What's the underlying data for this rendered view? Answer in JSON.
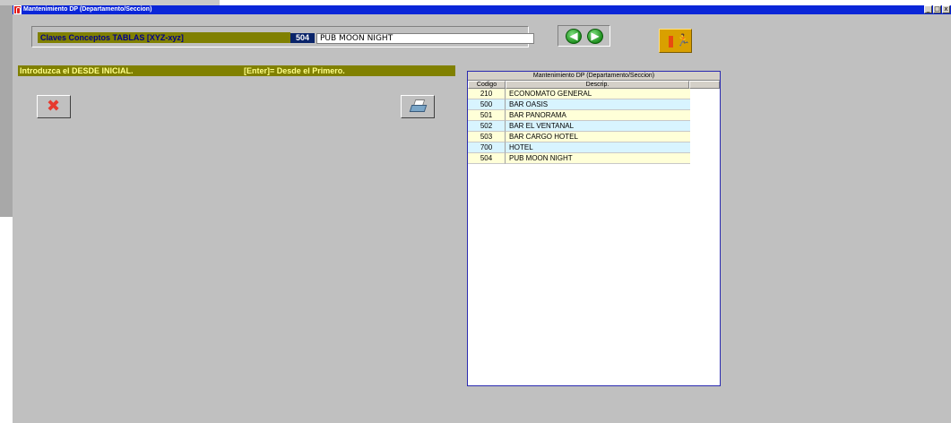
{
  "window": {
    "title": "Mantenimiento DP (Departamento/Seccion)",
    "min_label": "_",
    "max_label": "□",
    "close_label": "x"
  },
  "claves": {
    "label": "Claves Conceptos TABLAS [XYZ-xyz]",
    "code": "504",
    "description": "PUB MOON NIGHT"
  },
  "nav": {
    "prev_icon": "left-arrow-icon",
    "next_icon": "right-arrow-icon",
    "prev_glyph": "◀",
    "next_glyph": "▶"
  },
  "prompt": {
    "left": "Introduzca el DESDE INICIAL.",
    "right": "[Enter]= Desde el Primero."
  },
  "table": {
    "title": "Mantenimiento DP (Departamento/Seccion)",
    "headers": {
      "code": "Codigo",
      "desc": "Descrip."
    },
    "rows": [
      {
        "code": "210",
        "desc": "ECONOMATO GENERAL"
      },
      {
        "code": "500",
        "desc": "BAR OASIS"
      },
      {
        "code": "501",
        "desc": "BAR PANORAMA"
      },
      {
        "code": "502",
        "desc": "BAR EL VENTANAL"
      },
      {
        "code": "503",
        "desc": "BAR CARGO HOTEL"
      },
      {
        "code": "700",
        "desc": "HOTEL"
      },
      {
        "code": "504",
        "desc": "PUB MOON NIGHT"
      }
    ]
  },
  "colors": {
    "olive": "#808000",
    "titlebar": "#0a26d8",
    "window_bg": "#c0c0c0",
    "row_odd": "#ffffd8",
    "row_even": "#d8f4ff"
  }
}
